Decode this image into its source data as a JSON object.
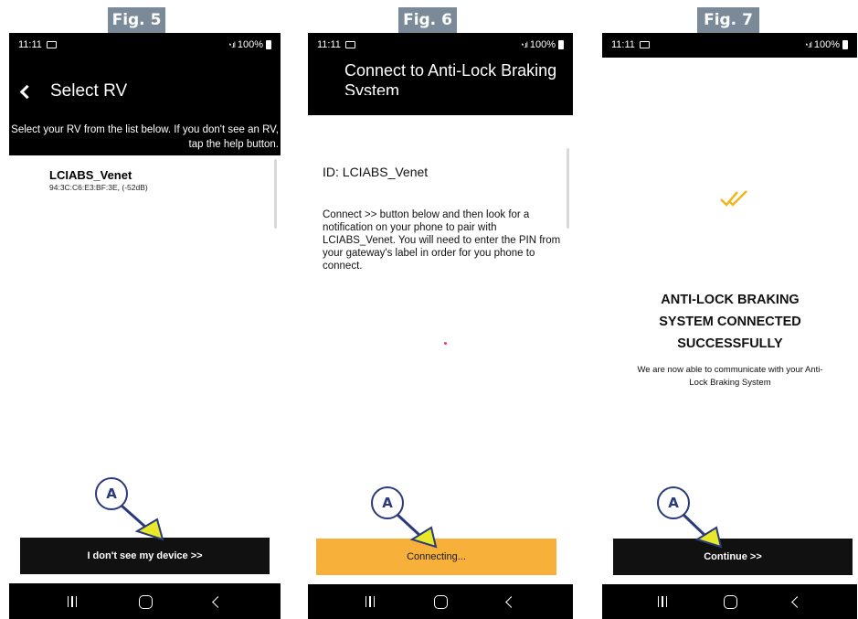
{
  "fig5": {
    "label": "Fig. 5",
    "time": "11:11",
    "battery": "100%",
    "title": "Select RV",
    "instructions": "Select your RV from the list below. If you don't see an RV, tap the help button.",
    "device_name": "LCIABS_Venet",
    "device_detail": "94:3C:C6:E3:BF:3E, (-52dB)",
    "button_label": "I don't see my device >>",
    "marker": "A"
  },
  "fig6": {
    "label": "Fig. 6",
    "time": "11:11",
    "battery": "100%",
    "title": "Connect to Anti-Lock Braking System",
    "id_line": "ID: LCIABS_Venet",
    "body": "Connect >>  button below and then look for a notification on your phone to pair with  LCIABS_Venet. You will need to enter the PIN from your gateway's label in order for you phone to connect.",
    "button_label": "Connecting...",
    "marker": "A"
  },
  "fig7": {
    "label": "Fig. 7",
    "time": "11:11",
    "battery": "100%",
    "headline": "ANTI-LOCK BRAKING SYSTEM CONNECTED SUCCESSFULLY",
    "subtext": "We are now able to communicate with your Anti-Lock Braking System",
    "button_label": "Continue >>",
    "marker": "A"
  },
  "colors": {
    "fig_label_bg": "#7b8a99",
    "connecting_bg": "#f7b03a",
    "check_accent": "#f2b51c",
    "marker_stroke": "#2a3a7a",
    "arrow_fill": "#e8e82a"
  },
  "icons": [
    "back-arrow-icon",
    "gallery-icon",
    "wifi-signal-icon",
    "battery-icon",
    "double-check-icon",
    "nav-recents-icon",
    "nav-home-icon",
    "nav-back-icon"
  ]
}
